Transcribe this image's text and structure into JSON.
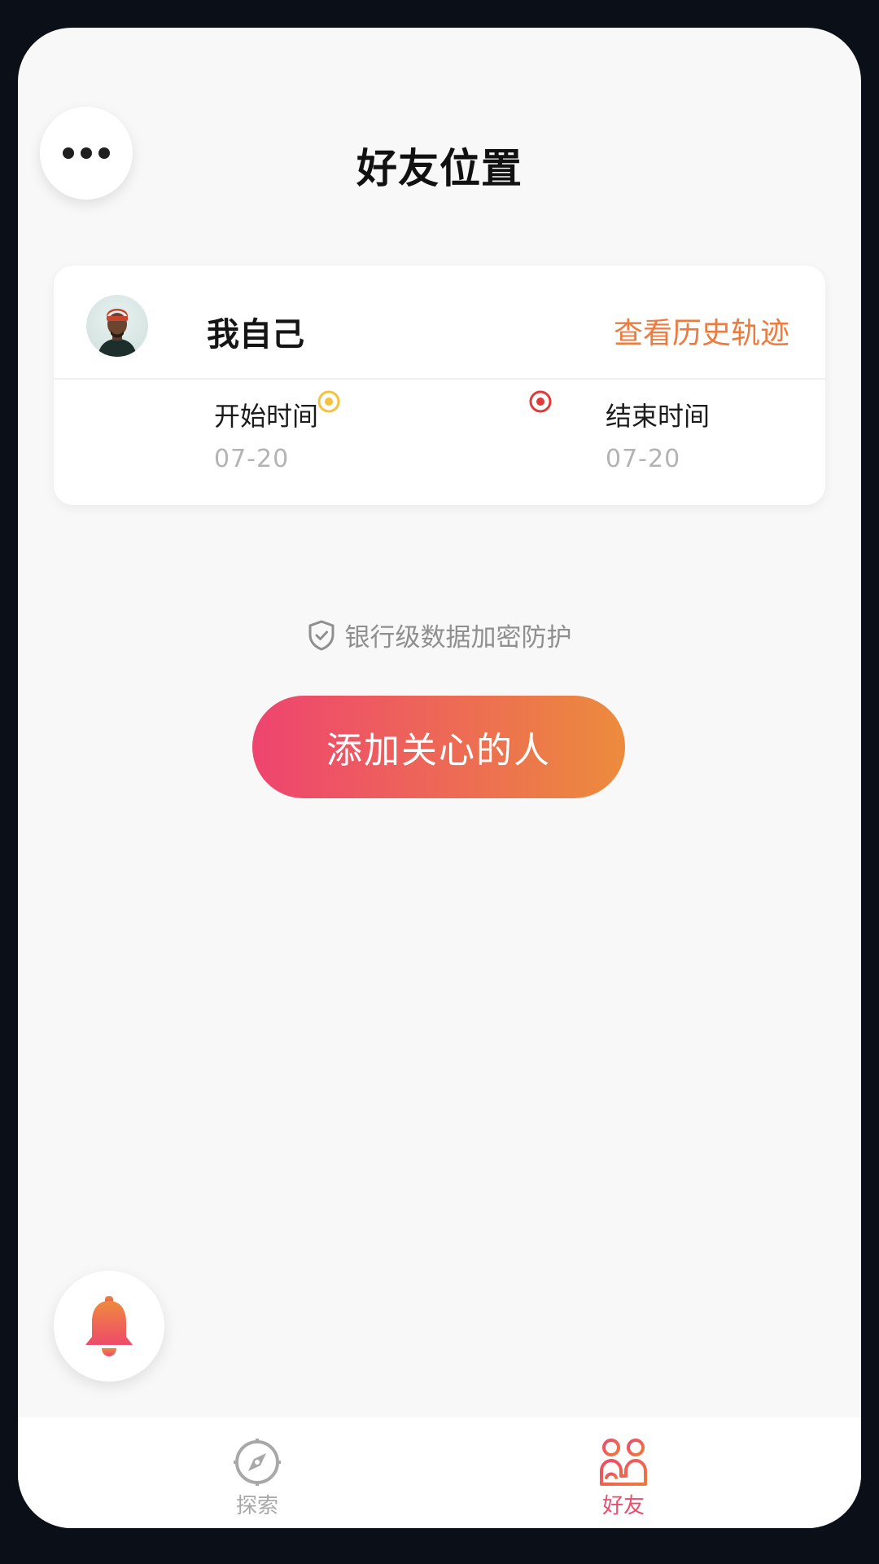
{
  "header": {
    "title": "好友位置",
    "more_icon": "more-horizontal-icon"
  },
  "self_card": {
    "name": "我自己",
    "history_link": "查看历史轨迹",
    "start_label": "开始时间",
    "start_date": "07-20",
    "end_label": "结束时间",
    "end_date": "07-20"
  },
  "security_notice": {
    "icon": "shield-check-icon",
    "text": "银行级数据加密防护"
  },
  "add_button": {
    "label": "添加关心的人"
  },
  "bell": {
    "icon": "bell-icon"
  },
  "tabbar": {
    "tabs": [
      {
        "label": "探索",
        "icon": "compass-icon",
        "active": false
      },
      {
        "label": "好友",
        "icon": "friends-icon",
        "active": true
      }
    ]
  },
  "colors": {
    "accent_orange": "#ee7a3d",
    "gradient_start": "#ee4470",
    "gradient_end": "#ec8b3d",
    "active_tab": "#ee4a6a",
    "inactive_tab": "#a8a8a8"
  }
}
